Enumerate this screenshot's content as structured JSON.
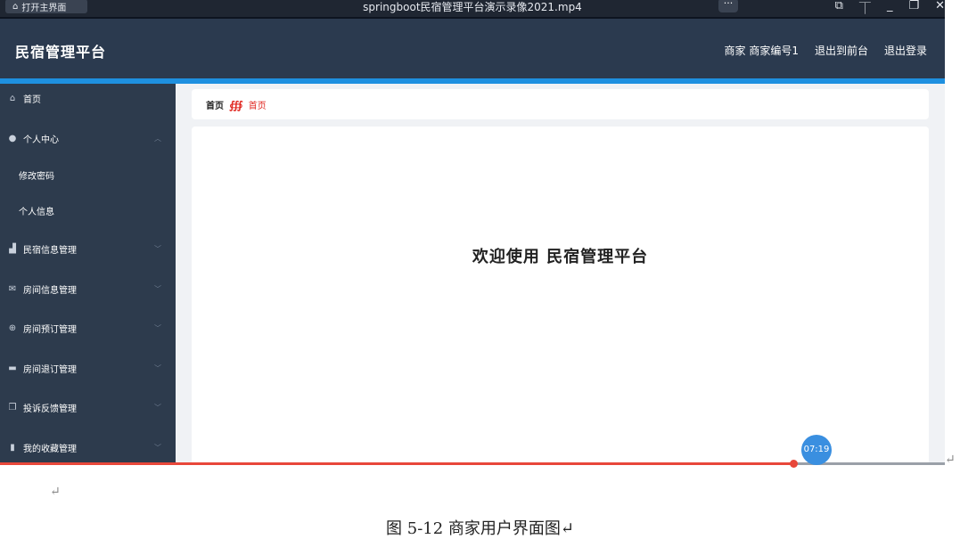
{
  "player": {
    "home_button": "打开主界面",
    "video_title": "springboot民宿管理平台演示录像2021.mp4",
    "more_button": "···",
    "window_controls": [
      "⧉",
      "⏉",
      "_",
      "❐",
      "✕"
    ],
    "current_time": "07:19",
    "progress_percent": 84
  },
  "header": {
    "app_title": "民宿管理平台",
    "user_role": "商家",
    "user_name": "商家编号1",
    "link_frontend": "退出到前台",
    "link_logout": "退出登录"
  },
  "sidebar": {
    "home": {
      "label": "首页",
      "icon": "home-icon"
    },
    "personal_center": {
      "label": "个人中心",
      "icon": "user-icon"
    },
    "change_password": "修改密码",
    "personal_info": "个人信息",
    "items": [
      {
        "label": "民宿信息管理",
        "icon": "thumb-icon"
      },
      {
        "label": "房间信息管理",
        "icon": "mail-icon"
      },
      {
        "label": "房间预订管理",
        "icon": "compass-icon"
      },
      {
        "label": "房间退订管理",
        "icon": "briefcase-icon"
      },
      {
        "label": "投诉反馈管理",
        "icon": "copy-icon"
      },
      {
        "label": "我的收藏管理",
        "icon": "bar-chart-icon"
      }
    ]
  },
  "breadcrumb": {
    "root": "首页",
    "current": "首页"
  },
  "main": {
    "welcome": "欢迎使用 民宿管理平台"
  },
  "document": {
    "caption": "图 5-12 商家用户界面图↵",
    "return_mark": "↵"
  },
  "colors": {
    "header_bg": "#2b3a4f",
    "sidebar_bg": "#2d3b4d",
    "accent_blue": "#1e90e0",
    "breadcrumb_red": "#e0261f"
  }
}
